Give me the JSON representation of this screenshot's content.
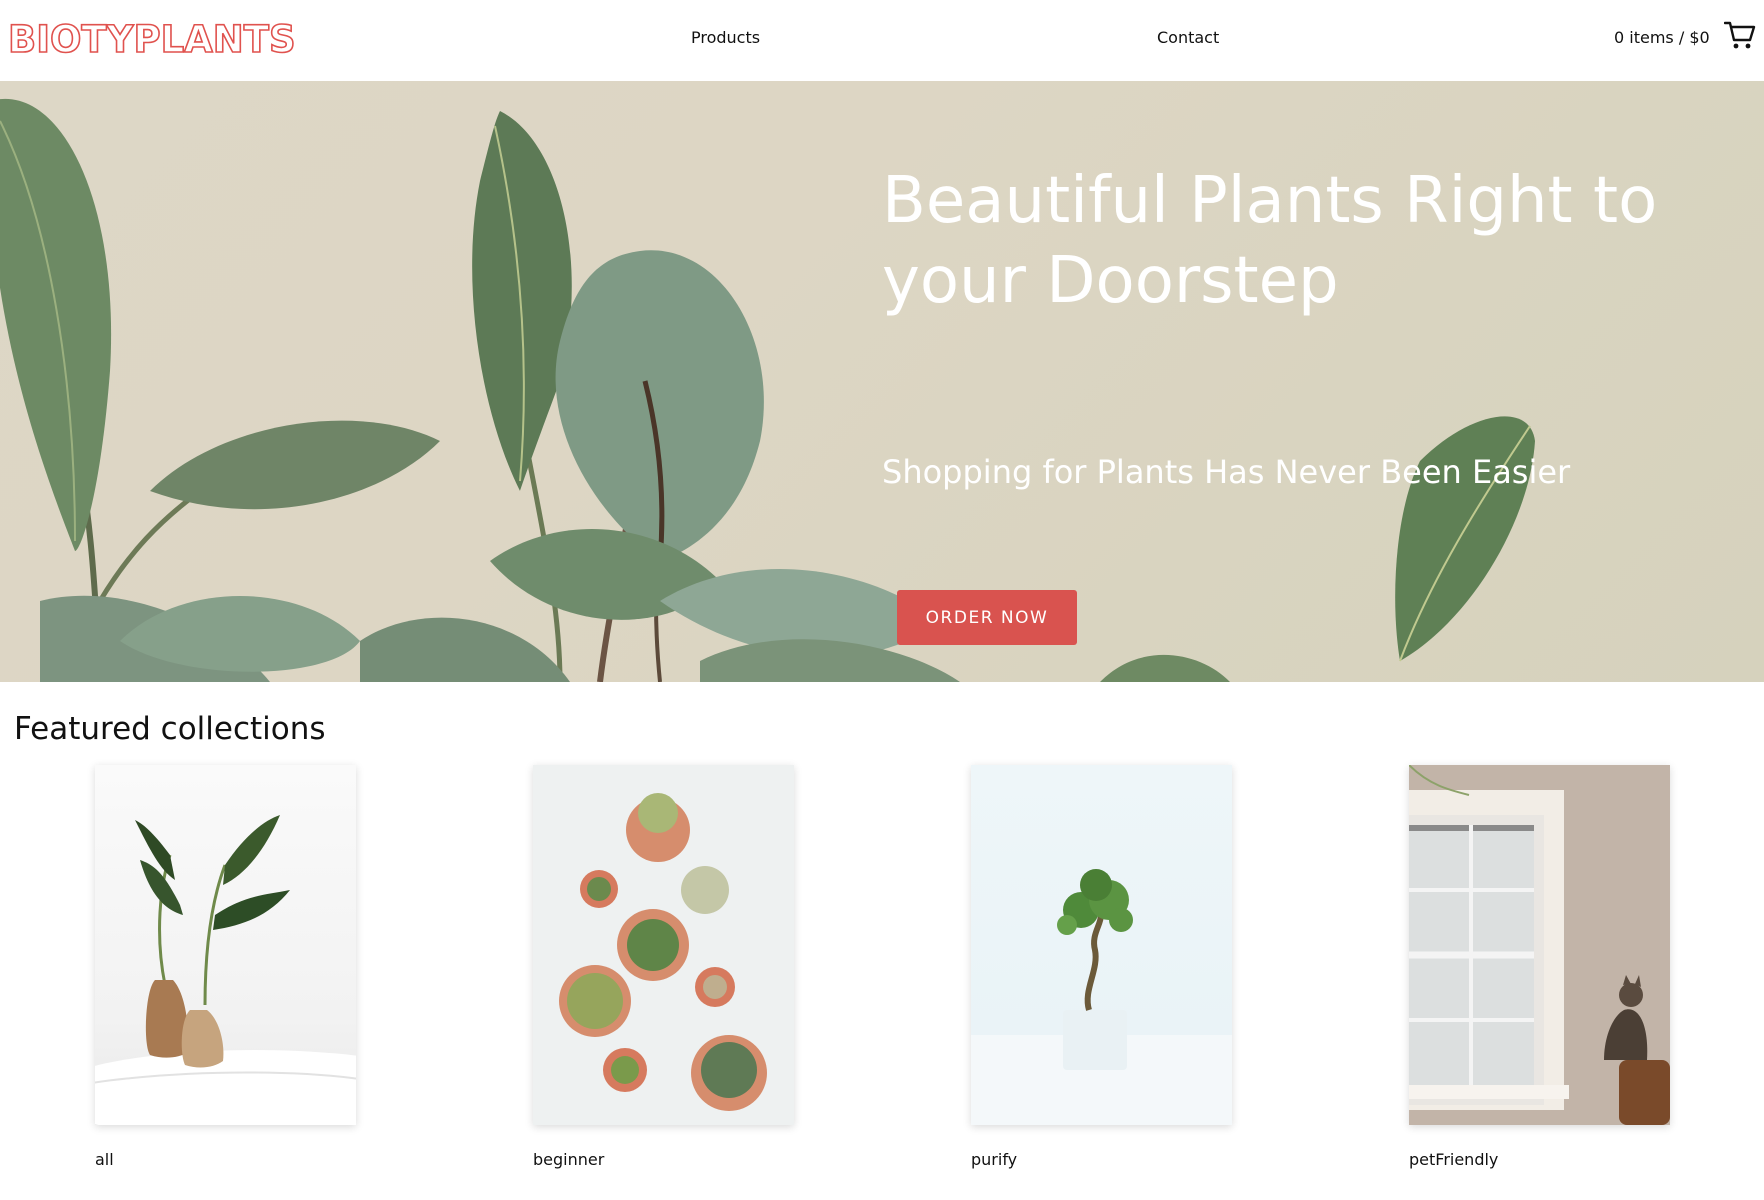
{
  "header": {
    "logo": "BIOTYPLANTS",
    "nav": [
      {
        "label": "Products"
      },
      {
        "label": "Contact"
      }
    ],
    "cart_summary": "0 items / $0",
    "cart_icon": "cart-icon"
  },
  "hero": {
    "title": "Beautiful Plants Right to your Doorstep",
    "subtitle": "Shopping for Plants Has Never Been Easier",
    "cta_label": "ORDER NOW"
  },
  "featured": {
    "title": "Featured collections",
    "collections": [
      {
        "label": "all"
      },
      {
        "label": "beginner"
      },
      {
        "label": "purify"
      },
      {
        "label": "petFriendly"
      }
    ]
  },
  "colors": {
    "brand": "#e0524e",
    "cta": "#d9534f",
    "hero_bg": "#ddd7c6"
  }
}
